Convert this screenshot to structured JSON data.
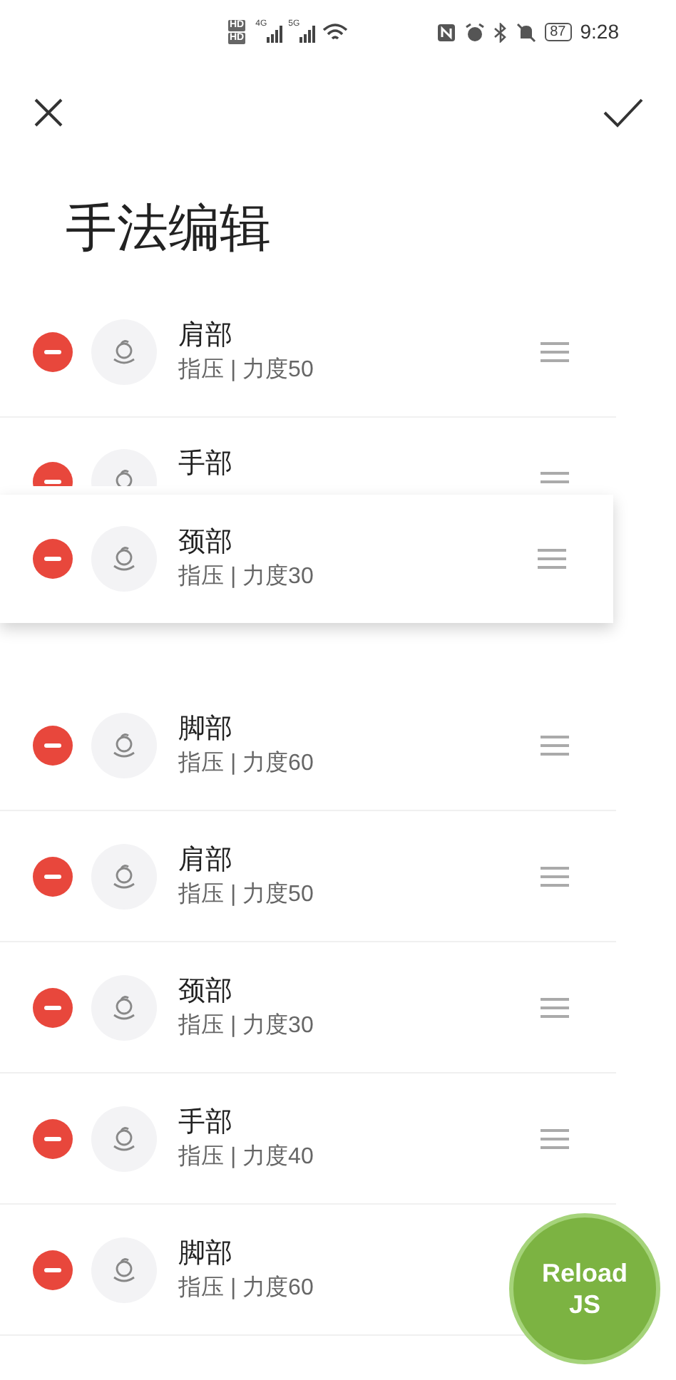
{
  "status_bar": {
    "sim_labels": [
      "HD",
      "HD"
    ],
    "network_labels": [
      "4G",
      "5G"
    ],
    "battery": "87",
    "time": "9:28"
  },
  "header": {
    "title": "手法编辑"
  },
  "items": [
    {
      "kind": "row",
      "title": "肩部",
      "subtitle": "指压 | 力度50"
    },
    {
      "kind": "row",
      "title": "手部"
    },
    {
      "kind": "empty_slot"
    },
    {
      "kind": "row",
      "title": "脚部",
      "subtitle": "指压 | 力度60"
    },
    {
      "kind": "row",
      "title": "肩部",
      "subtitle": "指压 | 力度50"
    },
    {
      "kind": "row",
      "title": "颈部",
      "subtitle": "指压 | 力度30"
    },
    {
      "kind": "row",
      "title": "手部",
      "subtitle": "指压 | 力度40"
    },
    {
      "kind": "row",
      "title": "脚部",
      "subtitle": "指压 | 力度60",
      "handle_covered": true
    }
  ],
  "dragged_item": {
    "title": "颈部",
    "subtitle": "指压 | 力度30"
  },
  "reload_button": {
    "label_lines": [
      "Reload",
      "JS"
    ]
  }
}
